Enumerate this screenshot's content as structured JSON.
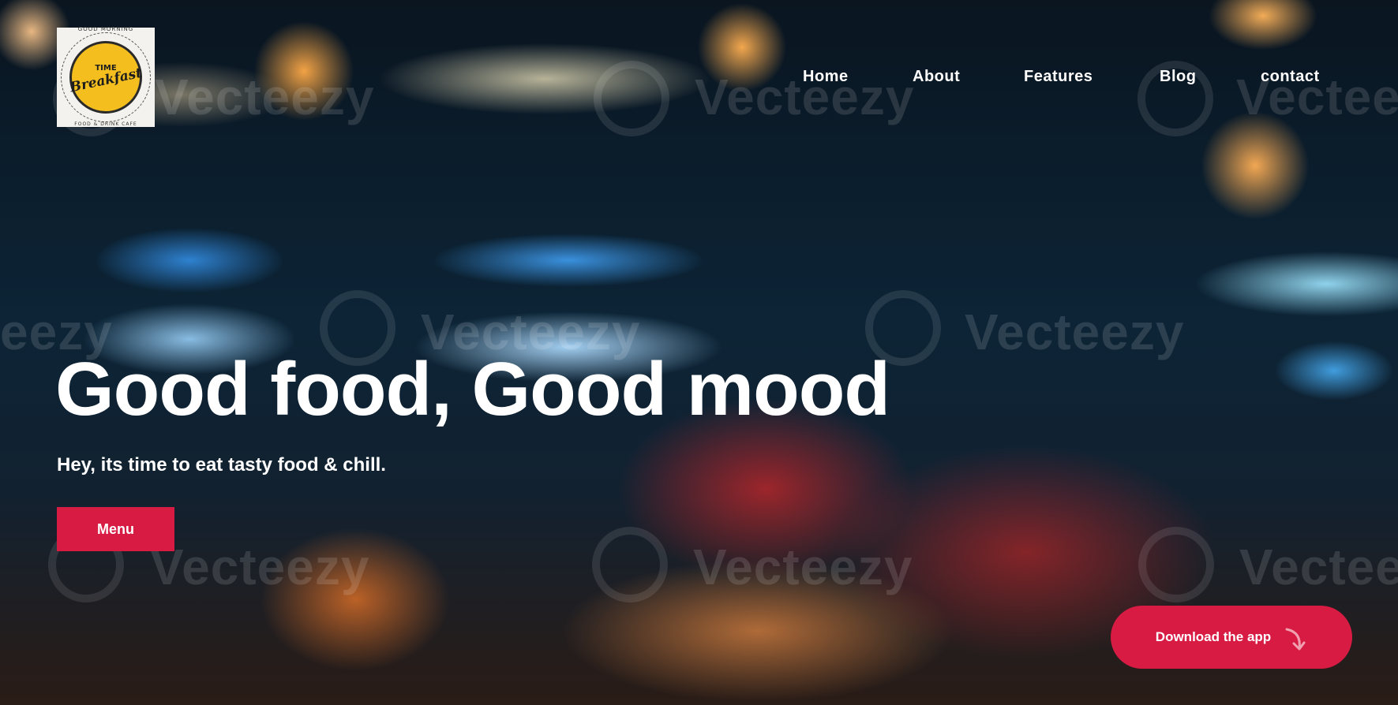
{
  "brand": {
    "logo_top": "GOOD MORNING",
    "logo_time": "TIME",
    "logo_name": "Breakfast",
    "logo_bottom": "FOOD & DRINK CAFE"
  },
  "nav": {
    "items": [
      {
        "label": "Home"
      },
      {
        "label": "About"
      },
      {
        "label": "Features"
      },
      {
        "label": "Blog"
      },
      {
        "label": "contact"
      }
    ]
  },
  "hero": {
    "headline": "Good food, Good mood",
    "subheadline": "Hey, its time to eat tasty food & chill.",
    "menu_button": "Menu",
    "download_button": "Download the app",
    "download_icon": "curved-arrow-down-icon"
  },
  "watermark": {
    "text": "Vecteezy",
    "fragment": "eezy"
  },
  "colors": {
    "accent": "#d81b43",
    "text": "#ffffff"
  }
}
